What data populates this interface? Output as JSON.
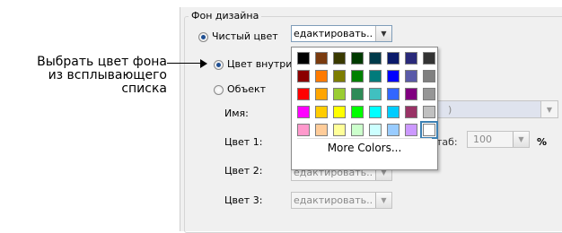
{
  "callout": {
    "line1": "Выбрать цвет фона",
    "line2": "из всплывающего",
    "line3": "списка"
  },
  "dialog": {
    "group_title": "Фон дизайна",
    "solid_color_label": "Чистый цвет",
    "edit_dropdown_value": "едактировать..",
    "inner_color_label": "Цвет внутри",
    "object_label": "Объект",
    "name_label": "Имя:",
    "name_field_value": ")",
    "color1_label": "Цвет 1:",
    "scale_label": "таб:",
    "scale_value": "100",
    "percent_label": "%",
    "color2_label": "Цвет 2:",
    "color2_value": "едактировать..",
    "color3_label": "Цвет 3:",
    "color3_value": "едактировать.."
  },
  "palette": {
    "more_colors_label": "More Colors...",
    "swatches": [
      "#000000",
      "#7a3b0f",
      "#3a3a00",
      "#003a00",
      "#003a4a",
      "#0a1a6a",
      "#2a2a7a",
      "#333333",
      "#8b0000",
      "#ff7a00",
      "#7d7d00",
      "#008000",
      "#007b7b",
      "#0000ff",
      "#5a5aa8",
      "#808080",
      "#ff0000",
      "#ffa500",
      "#9acd32",
      "#2e8b57",
      "#40c0c0",
      "#3366ff",
      "#800080",
      "#969696",
      "#ff00ff",
      "#ffcc00",
      "#ffff00",
      "#00ff00",
      "#00ffff",
      "#00ccff",
      "#993366",
      "#c0c0c0",
      "#ff99cc",
      "#ffcc99",
      "#ffff99",
      "#ccffcc",
      "#ccffff",
      "#99ccff",
      "#cc99ff",
      "#ffffff"
    ],
    "selected_index": 39
  }
}
